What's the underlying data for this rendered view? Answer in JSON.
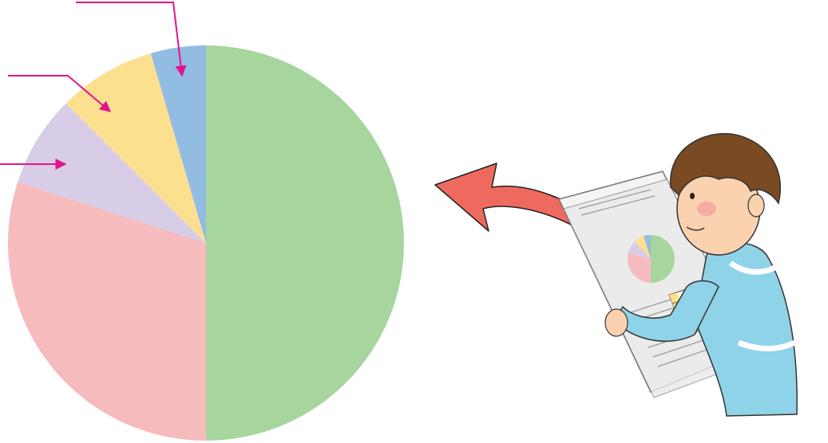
{
  "chart_data": {
    "type": "pie",
    "title": "",
    "slices": [
      {
        "value": 50,
        "color": "#a6d59e"
      },
      {
        "value": 30,
        "color": "#f6bbbd"
      },
      {
        "value": 7.5,
        "color": "#d8cde6"
      },
      {
        "value": 8,
        "color": "#fde08f"
      },
      {
        "value": 4.5,
        "color": "#93bce3"
      }
    ],
    "start": "12 o'clock",
    "direction": "clockwise",
    "annotation_color": "#e0158a",
    "labels_visible": false
  },
  "illustration": {
    "description_icon": "boy-reading-newspaper-icon",
    "arrow_color": "#ef6a5e"
  }
}
